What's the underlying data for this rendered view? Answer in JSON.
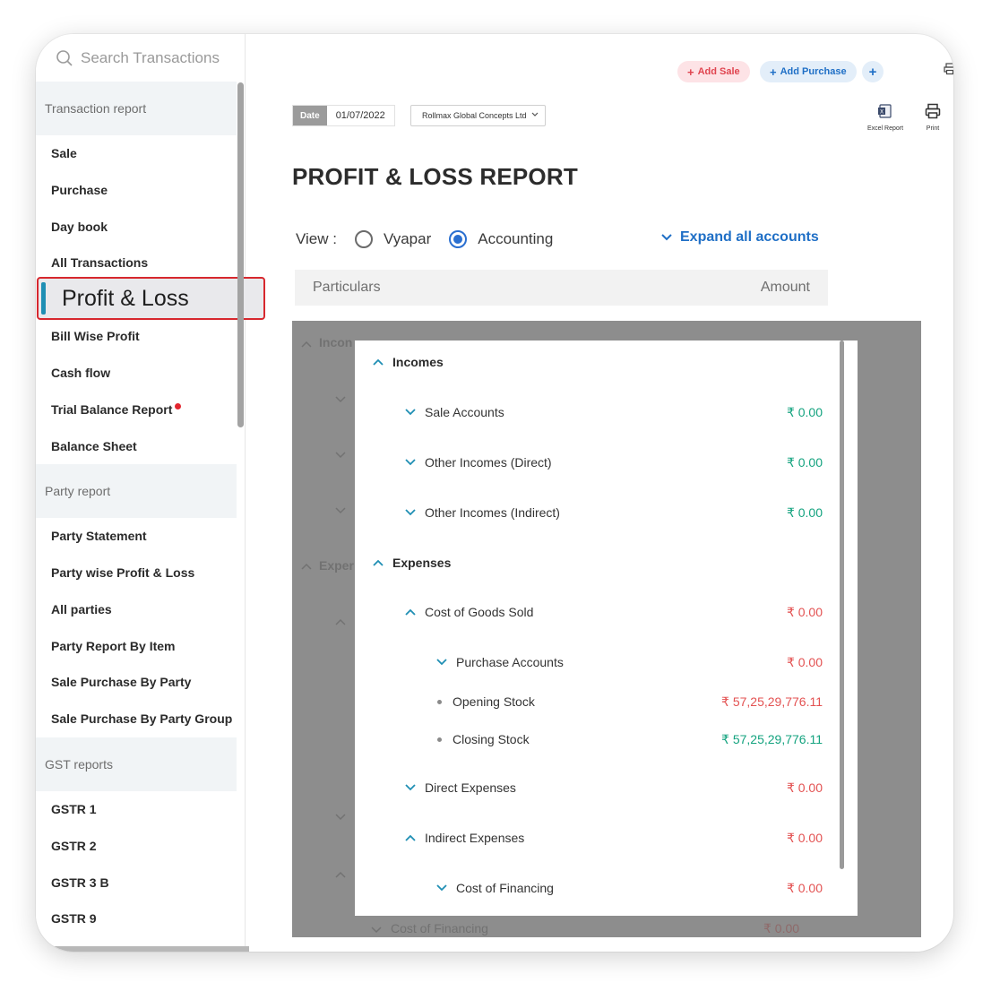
{
  "sidebar": {
    "search_placeholder": "Search Transactions",
    "sections": {
      "transaction": {
        "header": "Transaction report",
        "items": [
          "Sale",
          "Purchase",
          "Day book",
          "All Transactions",
          "Profit & Loss",
          "Bill Wise Profit",
          "Cash flow",
          "Trial Balance Report",
          "Balance Sheet"
        ]
      },
      "party": {
        "header": "Party report",
        "items": [
          "Party Statement",
          "Party wise Profit & Loss",
          "All parties",
          "Party Report By Item",
          "Sale Purchase By Party",
          "Sale Purchase By Party Group"
        ]
      },
      "gst": {
        "header": "GST reports",
        "items": [
          "GSTR 1",
          "GSTR 2",
          "GSTR 3 B",
          "GSTR 9"
        ]
      }
    },
    "active_item": "Profit & Loss"
  },
  "topbar": {
    "add_sale": "Add Sale",
    "add_purchase": "Add Purchase",
    "plus": "+"
  },
  "filters": {
    "date_label": "Date",
    "date_value": "01/07/2022",
    "firm": "Rollmax Global Concepts Ltd"
  },
  "tools": {
    "excel": "Excel Report",
    "print": "Print"
  },
  "report": {
    "title": "PROFIT & LOSS REPORT",
    "view_label": "View :",
    "view_options": [
      "Vyapar",
      "Accounting"
    ],
    "view_selected": "Accounting",
    "expand_all": "Expand all accounts",
    "col_particulars": "Particulars",
    "col_amount": "Amount"
  },
  "background": {
    "income_text": "Incon",
    "expense_text": "Exper",
    "bottom_label": "Cost of Financing",
    "bottom_amount": "₹ 0.00"
  },
  "modal": {
    "incomes": {
      "label": "Incomes",
      "rows": [
        {
          "label": "Sale Accounts",
          "amount": "₹ 0.00"
        },
        {
          "label": "Other Incomes (Direct)",
          "amount": "₹ 0.00"
        },
        {
          "label": "Other Incomes (Indirect)",
          "amount": "₹ 0.00"
        }
      ]
    },
    "expenses": {
      "label": "Expenses",
      "cogs": {
        "label": "Cost of Goods Sold",
        "amount": "₹ 0.00"
      },
      "purchase_accounts": {
        "label": "Purchase Accounts",
        "amount": "₹ 0.00"
      },
      "opening_stock": {
        "label": "Opening Stock",
        "amount": "₹ 57,25,29,776.11"
      },
      "closing_stock": {
        "label": "Closing Stock",
        "amount": "₹ 57,25,29,776.11"
      },
      "direct_expenses": {
        "label": "Direct Expenses",
        "amount": "₹ 0.00"
      },
      "indirect_expenses": {
        "label": "Indirect Expenses",
        "amount": "₹ 0.00"
      },
      "cost_of_financing": {
        "label": "Cost of Financing",
        "amount": "₹ 0.00"
      }
    }
  },
  "colors": {
    "accent_blue": "#1f6fc6",
    "positive_green": "#14a37f",
    "negative_red": "#e35252",
    "active_border": "#d7282e"
  }
}
